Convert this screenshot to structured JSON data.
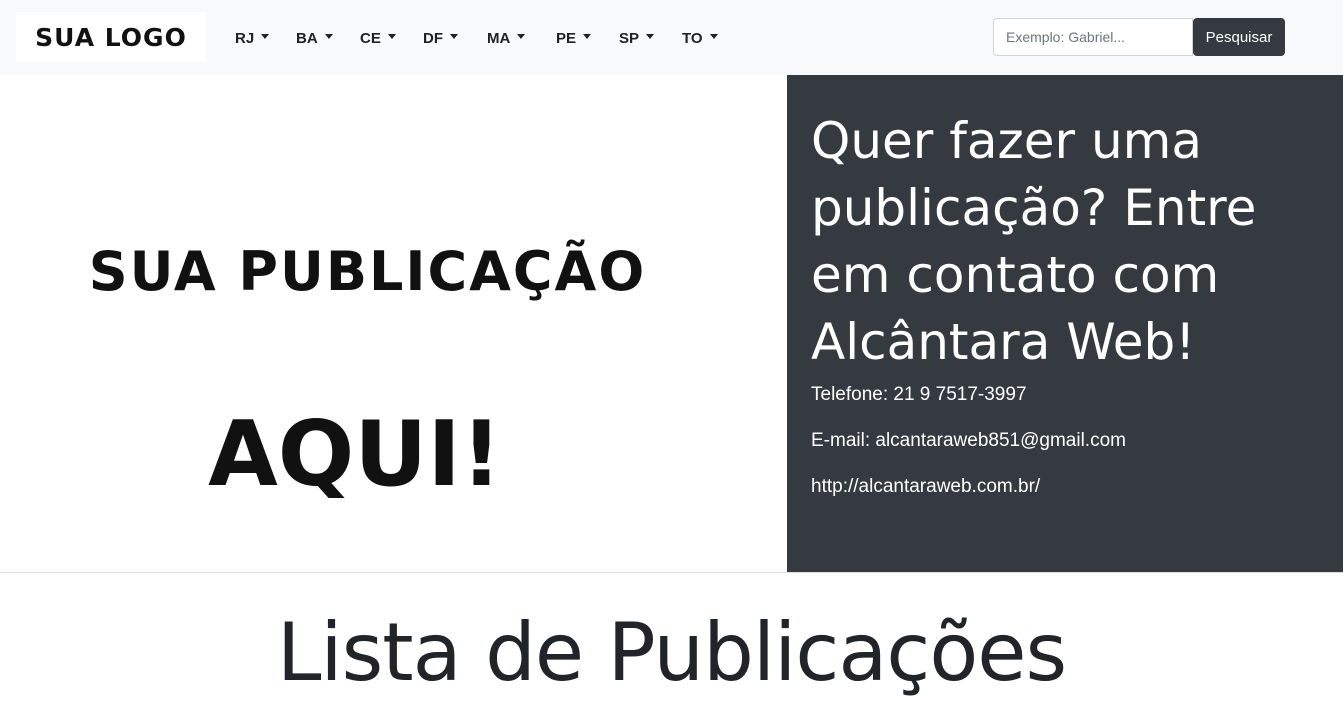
{
  "navbar": {
    "logo_text": "SUA LOGO",
    "menu": [
      {
        "label": "RJ",
        "icon": "caret-down-icon"
      },
      {
        "label": "BA",
        "icon": "caret-down-icon"
      },
      {
        "label": "CE",
        "icon": "caret-down-icon"
      },
      {
        "label": "DF",
        "icon": "caret-down-icon"
      },
      {
        "label": "MA",
        "icon": "caret-down-icon"
      },
      {
        "label": "PE",
        "icon": "caret-down-icon"
      },
      {
        "label": "SP",
        "icon": "caret-down-icon"
      },
      {
        "label": "TO",
        "icon": "caret-down-icon"
      }
    ],
    "search": {
      "placeholder": "Exemplo: Gabriel...",
      "value": "",
      "button_label": "Pesquisar"
    }
  },
  "banner": {
    "line1": "SUA PUBLICAÇÃO",
    "line2": "AQUI!"
  },
  "contact": {
    "title": "Quer fazer uma publicação? Entre em contato com Alcântara Web!",
    "phone": "Telefone: 21 9 7517-3997",
    "email": "E-mail: alcantaraweb851@gmail.com",
    "website": "http://alcantaraweb.com.br/"
  },
  "list": {
    "title": "Lista de Publicações"
  },
  "colors": {
    "navbar_bg": "#f8f9fa",
    "dark_panel": "#343a40",
    "button_bg": "#343a40"
  }
}
